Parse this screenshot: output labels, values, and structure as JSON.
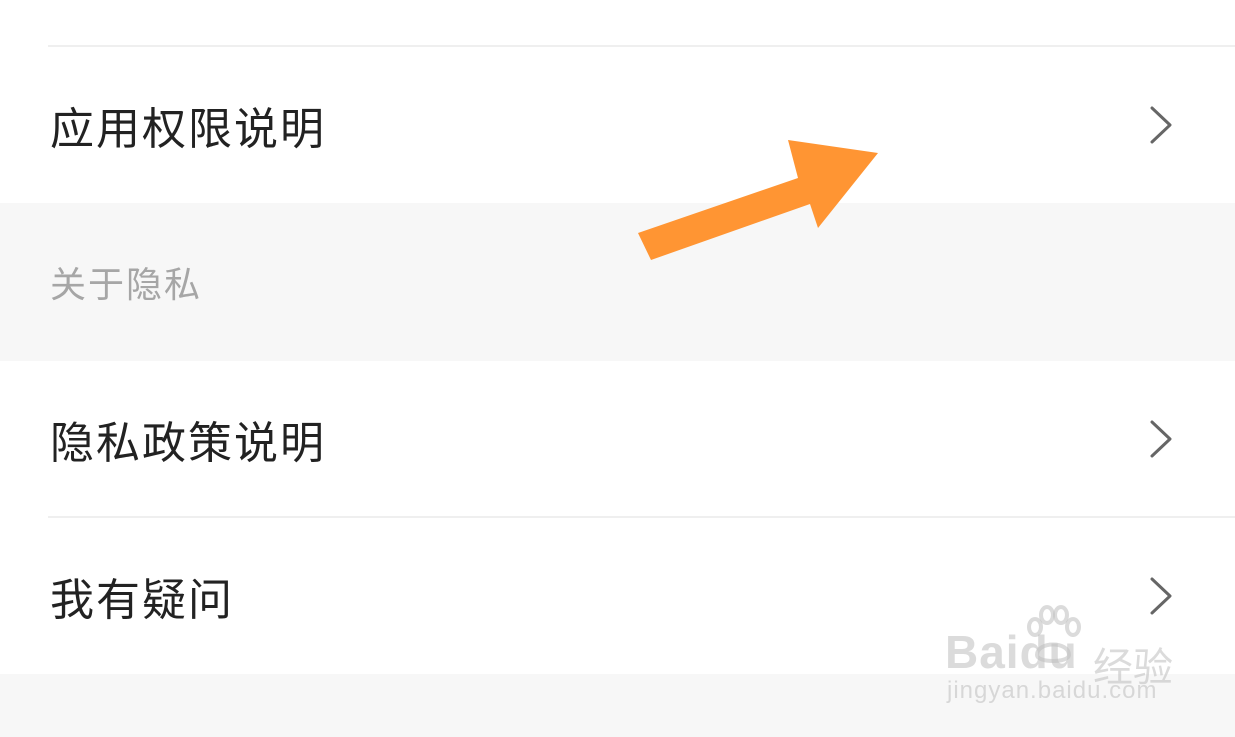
{
  "settings": {
    "rows": [
      {
        "label": "应用权限说明"
      },
      {
        "label": "隐私政策说明"
      },
      {
        "label": "我有疑问"
      }
    ],
    "section_header": "关于隐私"
  },
  "watermark": {
    "brand": "Baidu",
    "brand_suffix": "经验",
    "url": "jingyan.baidu.com"
  },
  "colors": {
    "arrow": "#FF9533",
    "row_text": "#222222",
    "section_text": "#A6A6A6",
    "section_bg": "#F7F7F7",
    "chevron": "#666666"
  }
}
